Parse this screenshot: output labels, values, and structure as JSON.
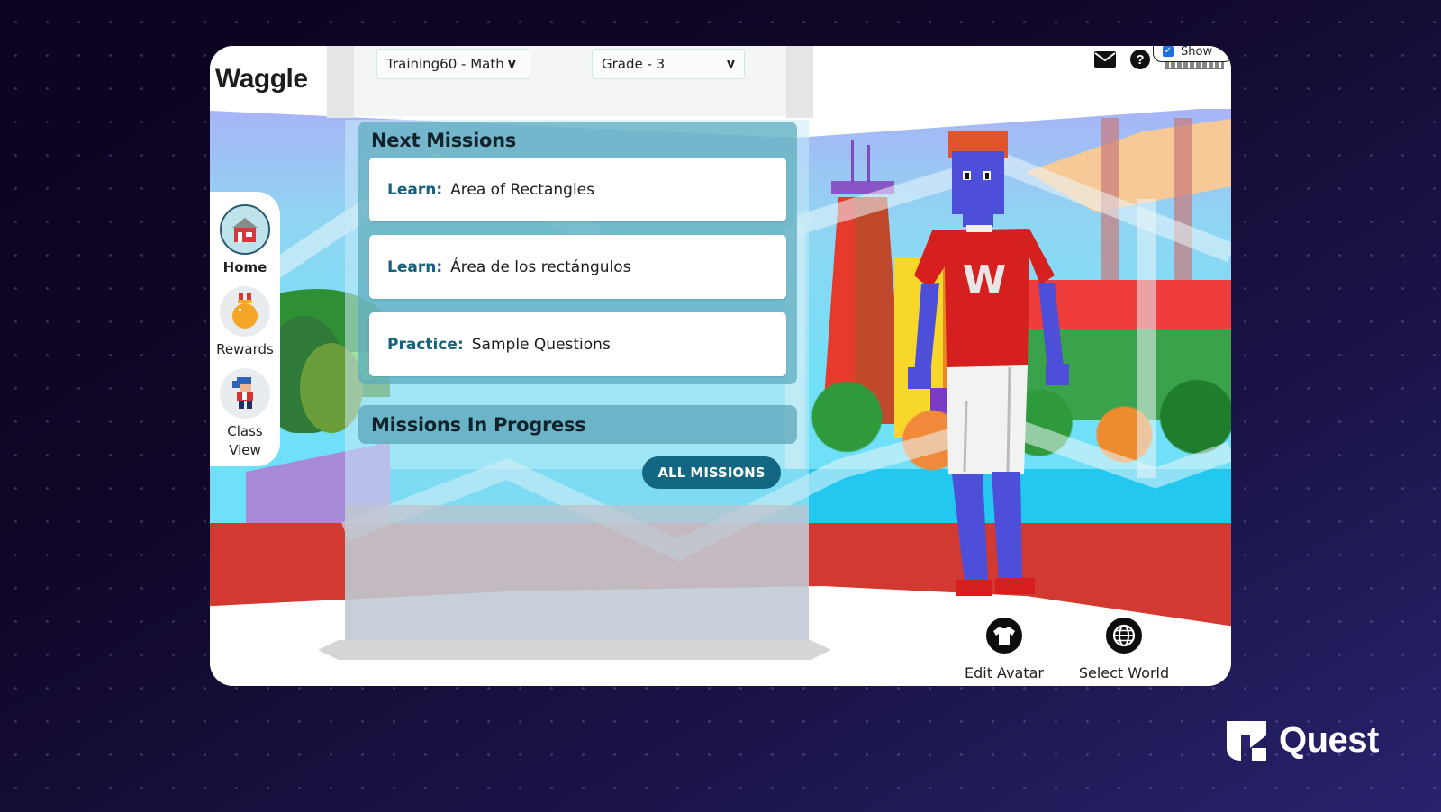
{
  "app": {
    "logo": "Waggle"
  },
  "header": {
    "class_select": {
      "value": "Training60 - Math",
      "arrow": "v"
    },
    "grade_select": {
      "value": "Grade - 3",
      "arrow": "v"
    },
    "show_toggle": {
      "label": "Show",
      "checked": true
    },
    "icons": [
      "mail-icon",
      "help-icon"
    ],
    "help_glyph": "?"
  },
  "sidebar": {
    "items": [
      {
        "label": "Home",
        "icon": "home-icon",
        "active": true
      },
      {
        "label": "Rewards",
        "icon": "medal-icon",
        "active": false
      },
      {
        "label": "Class View",
        "icon": "student-icon",
        "active": false
      }
    ]
  },
  "next_missions": {
    "title": "Next Missions",
    "items": [
      {
        "type": "Learn:",
        "title": "Area of Rectangles"
      },
      {
        "type": "Learn:",
        "title": "Área de los rectángulos"
      },
      {
        "type": "Practice:",
        "title": "Sample Questions"
      }
    ]
  },
  "missions_in_progress": {
    "title": "Missions In Progress",
    "button_label": "ALL MISSIONS"
  },
  "actions": {
    "edit_avatar": "Edit Avatar",
    "select_world": "Select World"
  },
  "avatar": {
    "shirt_letter": "W"
  },
  "branding": {
    "name": "Quest"
  },
  "colors": {
    "accent": "#136783",
    "mission_type": "#16627d",
    "panel": "#5aaabc",
    "background": "#0e0420"
  }
}
